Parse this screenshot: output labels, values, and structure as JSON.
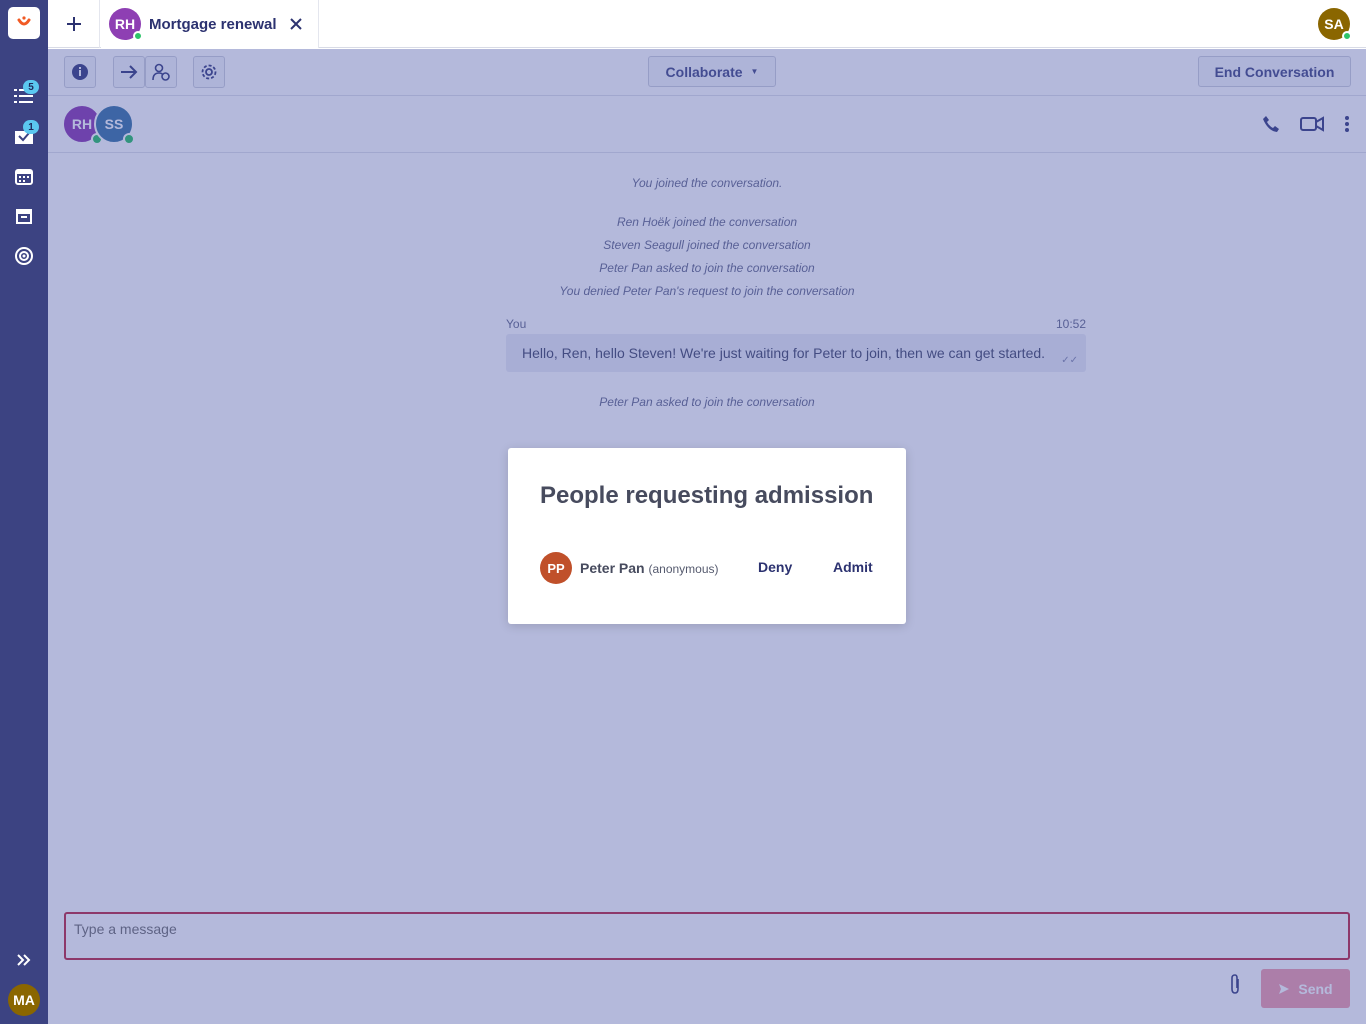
{
  "sidebar": {
    "logo_icon": "unblu-logo-icon",
    "items": [
      {
        "icon": "list-icon",
        "badge": "5"
      },
      {
        "icon": "inbox-icon",
        "badge": "1"
      },
      {
        "icon": "calendar-icon",
        "badge": ""
      },
      {
        "icon": "archive-icon",
        "badge": ""
      },
      {
        "icon": "broadcast-icon",
        "badge": ""
      }
    ],
    "user_initials": "MA"
  },
  "topbar": {
    "tab": {
      "initials": "RH",
      "title": "Mortgage renewal"
    },
    "user_initials": "SA"
  },
  "toolbar": {
    "collaborate_label": "Collaborate",
    "end_label": "End Conversation"
  },
  "participants": [
    {
      "initials": "RH",
      "color": "#8e3fb3"
    },
    {
      "initials": "SS",
      "color": "#3f78a8"
    }
  ],
  "messages": {
    "system": [
      "You joined the conversation.",
      "Ren Hoëk joined the conversation",
      "Steven Seagull joined the conversation",
      "Peter Pan asked to join the conversation",
      "You denied Peter Pan's request to join the conversation"
    ],
    "chat": {
      "sender": "You",
      "time": "10:52",
      "text": "Hello, Ren, hello Steven! We're just waiting for Peter to join, then we can get started."
    },
    "after": "Peter Pan asked to join the conversation"
  },
  "composer": {
    "placeholder": "Type a message",
    "send_label": "Send"
  },
  "modal": {
    "title": "People requesting admission",
    "request": {
      "initials": "PP",
      "name": "Peter Pan",
      "tag": "(anonymous)"
    },
    "deny_label": "Deny",
    "admit_label": "Admit"
  },
  "colors": {
    "sidebar": "#3c4382",
    "overlay": "#3a48a0",
    "accent": "#2c3270",
    "online": "#2ec46a"
  }
}
